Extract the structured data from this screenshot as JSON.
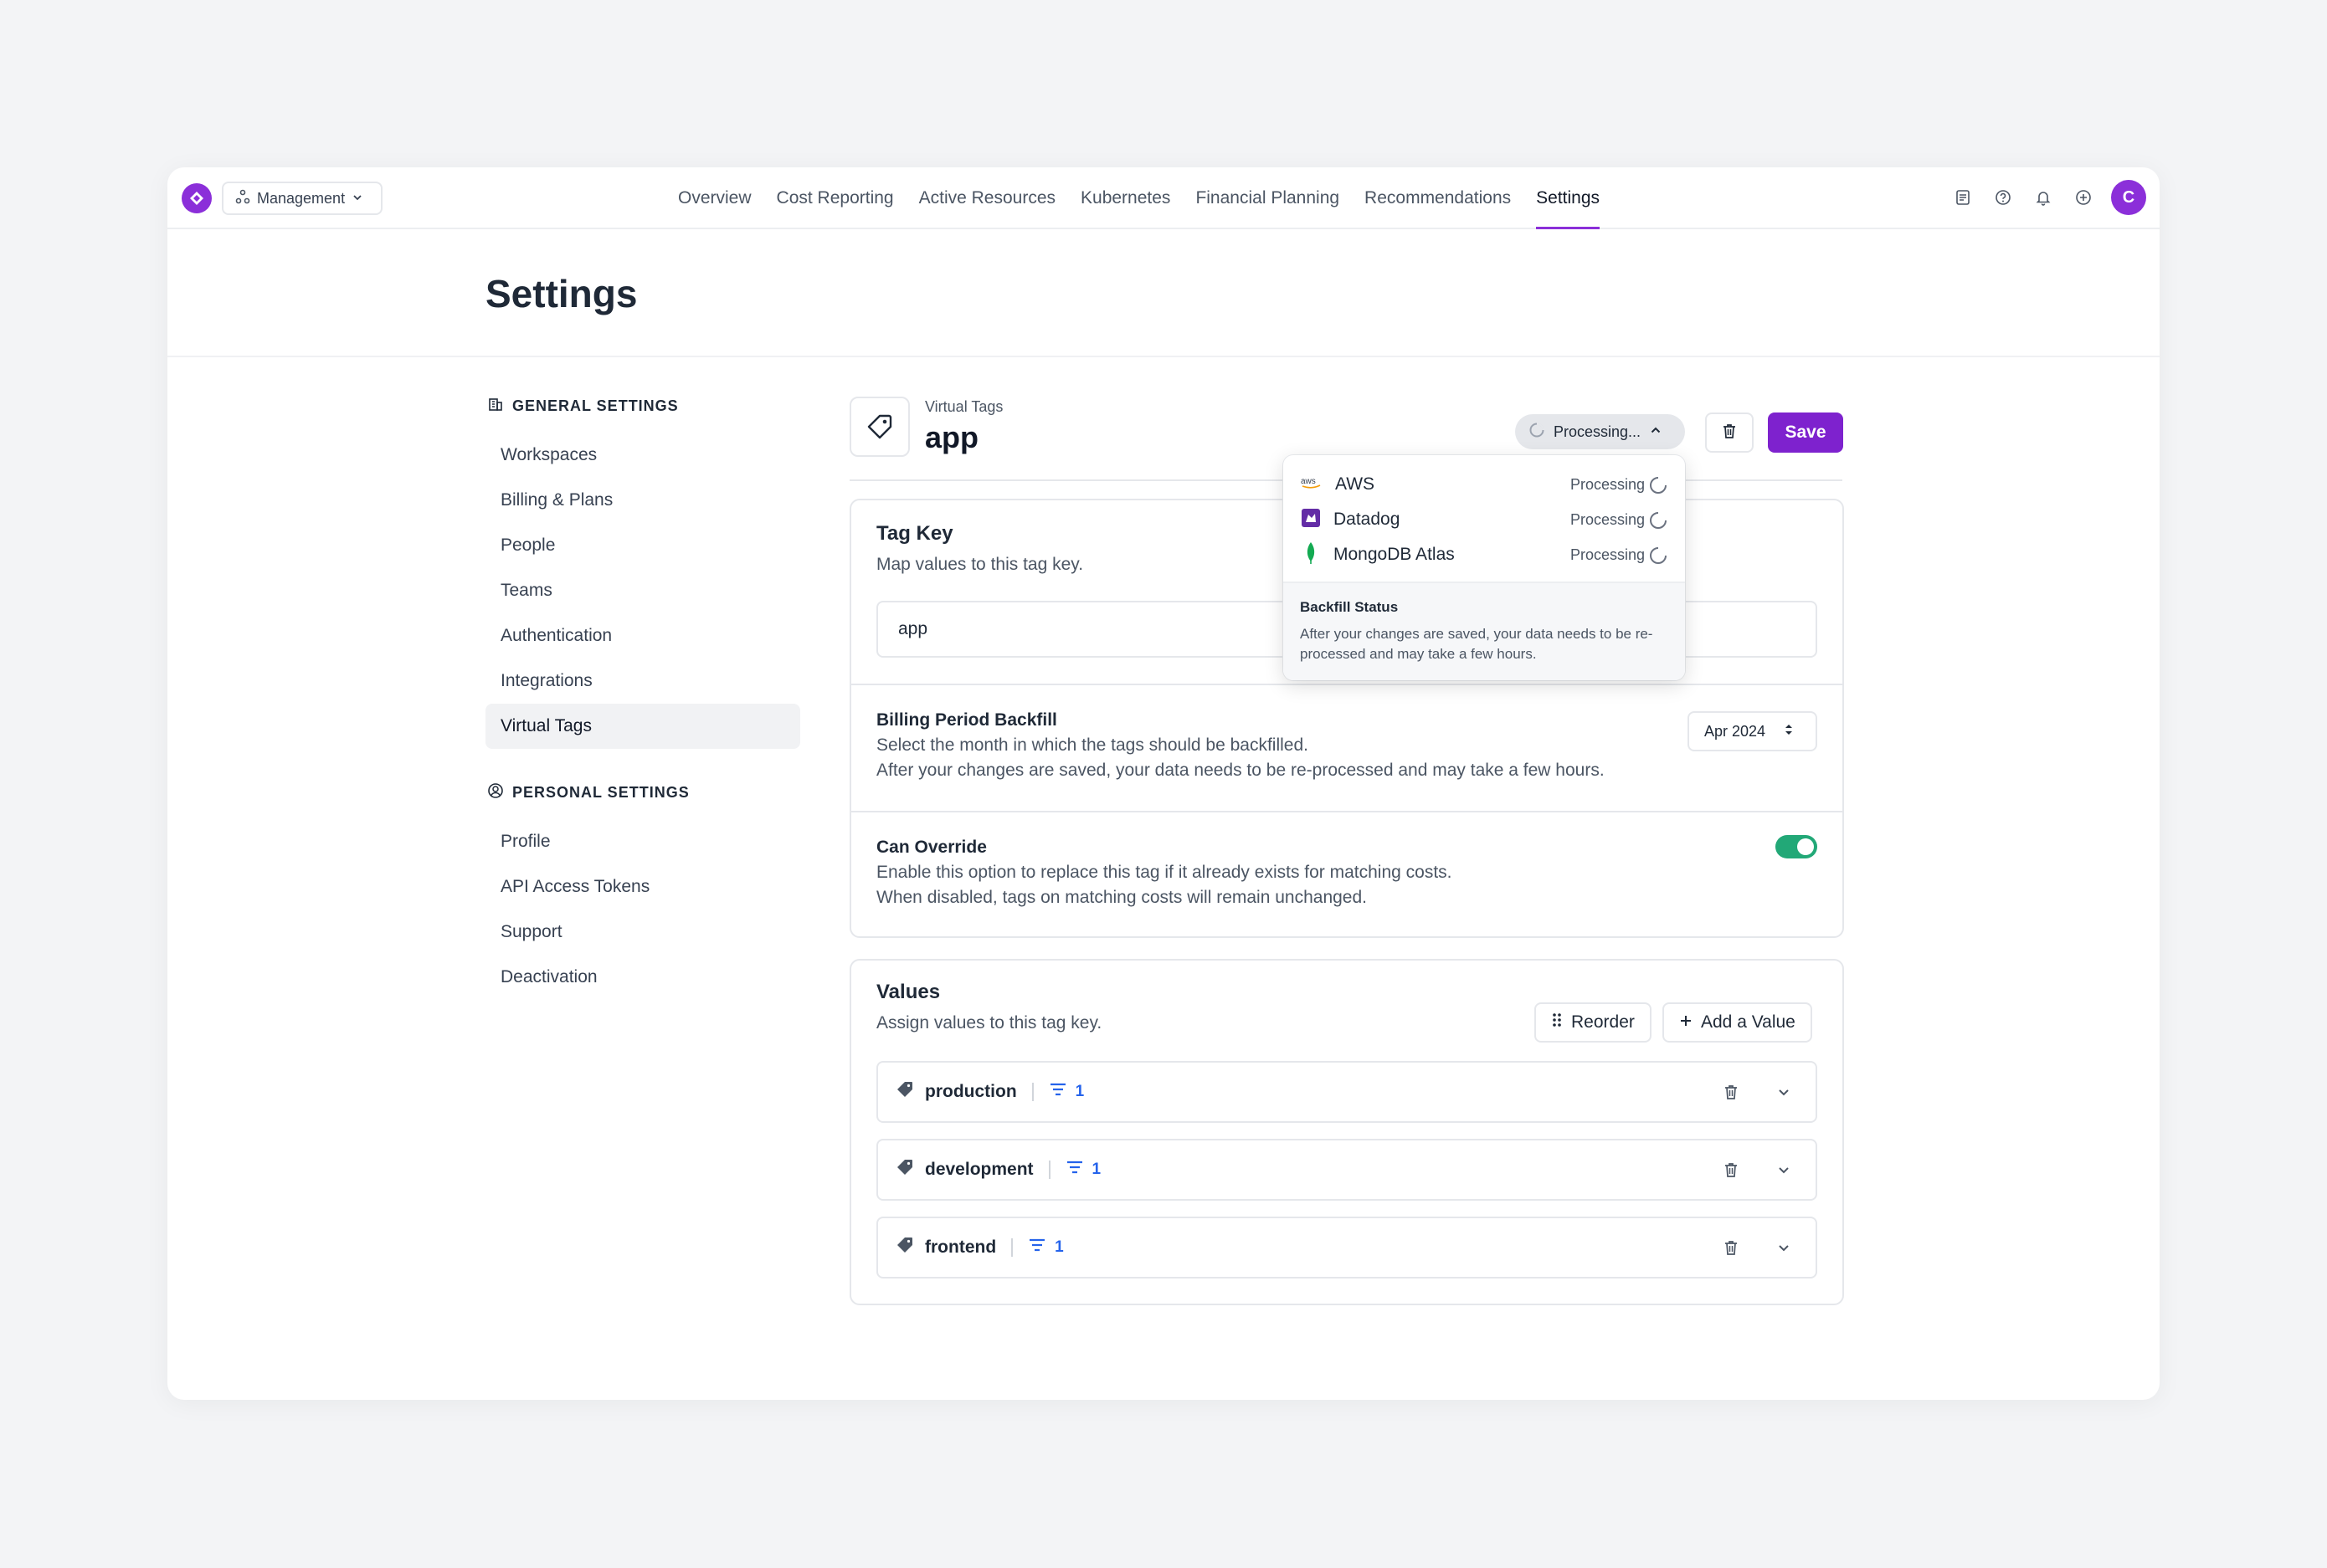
{
  "nav": {
    "workspace": "Management",
    "tabs": [
      "Overview",
      "Cost Reporting",
      "Active Resources",
      "Kubernetes",
      "Financial Planning",
      "Recommendations",
      "Settings"
    ],
    "active_tab": "Settings",
    "avatar_initial": "C",
    "icons": [
      "docs-icon",
      "help-icon",
      "bell-icon",
      "plus-circle-icon"
    ]
  },
  "page": {
    "title": "Settings"
  },
  "sidebar": {
    "general_label": "GENERAL SETTINGS",
    "general_items": [
      "Workspaces",
      "Billing & Plans",
      "People",
      "Teams",
      "Authentication",
      "Integrations",
      "Virtual Tags"
    ],
    "active_item": "Virtual Tags",
    "personal_label": "PERSONAL SETTINGS",
    "personal_items": [
      "Profile",
      "API Access Tokens",
      "Support",
      "Deactivation"
    ]
  },
  "virtual_tag": {
    "breadcrumb": "Virtual Tags",
    "name": "app",
    "status_button": "Processing...",
    "save_label": "Save"
  },
  "tag_key": {
    "title": "Tag Key",
    "subtitle": "Map values to this tag key.",
    "value": "app"
  },
  "backfill": {
    "title": "Billing Period Backfill",
    "line1": "Select the month in which the tags should be backfilled.",
    "line2": "After your changes are saved, your data needs to be re-processed and may take a few hours.",
    "month": "Apr 2024"
  },
  "override": {
    "title": "Can Override",
    "line1": "Enable this option to replace this tag if it already exists for matching costs.",
    "line2": "When disabled, tags on matching costs will remain unchanged.",
    "enabled": true,
    "color": "#22a877"
  },
  "values": {
    "title": "Values",
    "subtitle": "Assign values to this tag key.",
    "reorder_label": "Reorder",
    "add_label": "Add a Value",
    "rows": [
      {
        "label": "production",
        "count": "1"
      },
      {
        "label": "development",
        "count": "1"
      },
      {
        "label": "frontend",
        "count": "1"
      }
    ]
  },
  "processing_dropdown": {
    "providers": [
      {
        "name": "AWS",
        "status": "Processing",
        "icon": "aws-icon"
      },
      {
        "name": "Datadog",
        "status": "Processing",
        "icon": "datadog-icon"
      },
      {
        "name": "MongoDB Atlas",
        "status": "Processing",
        "icon": "mongodb-icon"
      }
    ],
    "footer_title": "Backfill Status",
    "footer_text": "After your changes are saved, your data needs to be re-processed and may take a few hours."
  },
  "colors": {
    "accent": "#7e22ce",
    "toggle_on": "#22a877",
    "link_blue": "#2563eb"
  }
}
